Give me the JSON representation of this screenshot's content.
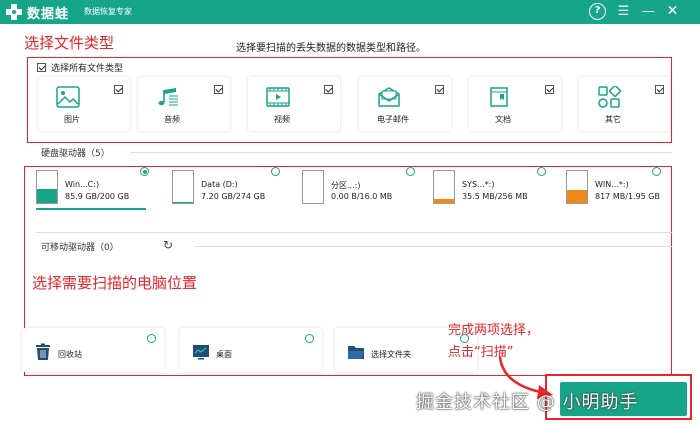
{
  "app": {
    "name": "数据蛙",
    "subtitle": "数据恢复专家"
  },
  "window_controls": {
    "help": "?",
    "menu": "☰",
    "minimize": "—",
    "close": "✕"
  },
  "annotations": {
    "select_type": "选择文件类型",
    "select_location": "选择需要扫描的电脑位置",
    "complete_line1": "完成两项选择，",
    "complete_line2": "点击“扫描”"
  },
  "instruction": "选择要扫描的丢失数据的数据类型和路径。",
  "select_all": {
    "label": "选择所有文件类型",
    "checked": true
  },
  "file_types": [
    {
      "label": "图片",
      "icon": "image-icon",
      "checked": true
    },
    {
      "label": "音频",
      "icon": "music-icon",
      "checked": true
    },
    {
      "label": "视频",
      "icon": "video-icon",
      "checked": true
    },
    {
      "label": "电子邮件",
      "icon": "email-icon",
      "checked": true
    },
    {
      "label": "文档",
      "icon": "document-icon",
      "checked": true
    },
    {
      "label": "其它",
      "icon": "other-icon",
      "checked": true
    }
  ],
  "hard_drives": {
    "label": "硬盘驱动器（5）",
    "drives": [
      {
        "name": "Win...C:)",
        "size": "85.9 GB/200 GB",
        "fill": 0.43,
        "color": "#17a589",
        "selected": true
      },
      {
        "name": "Data (D:)",
        "size": "7.20 GB/274 GB",
        "fill": 0.03,
        "color": "#17a589",
        "selected": false
      },
      {
        "name": "分区...:)",
        "size": "0.00  B/16.0 MB",
        "fill": 0.0,
        "color": "#17a589",
        "selected": false
      },
      {
        "name": "SYS...*:)",
        "size": "35.5 MB/256 MB",
        "fill": 0.14,
        "color": "#ef8a1a",
        "selected": false
      },
      {
        "name": "WIN...*:)",
        "size": "817 MB/1.95 GB",
        "fill": 0.42,
        "color": "#ef8a1a",
        "selected": false
      }
    ]
  },
  "removable": {
    "label": "可移动驱动器（0）"
  },
  "locations": [
    {
      "label": "回收站",
      "icon": "recycle-bin-icon"
    },
    {
      "label": "桌面",
      "icon": "desktop-icon"
    },
    {
      "label": "选择文件夹",
      "icon": "folder-icon"
    }
  ],
  "watermark": "掘金技术社区 @ 小明助手",
  "colors": {
    "brand": "#17a589",
    "annotation": "#e8242c",
    "warn": "#ef8a1a"
  }
}
